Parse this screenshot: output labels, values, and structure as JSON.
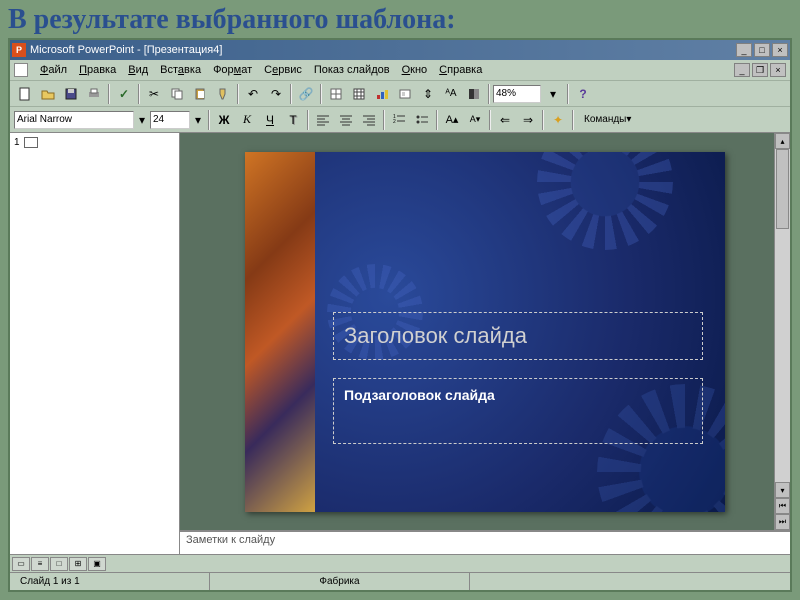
{
  "page": {
    "title": "В результате выбранного шаблона:"
  },
  "window": {
    "app_name": "Microsoft PowerPoint",
    "doc_name": "[Презентация4]"
  },
  "menu": {
    "file": "Файл",
    "edit": "Правка",
    "view": "Вид",
    "insert": "Вставка",
    "format": "Формат",
    "tools": "Сервис",
    "slideshow": "Показ слайдов",
    "window": "Окно",
    "help": "Справка"
  },
  "toolbar": {
    "zoom": "48%"
  },
  "format": {
    "font": "Arial Narrow",
    "size": "24",
    "commands": "Команды"
  },
  "slide": {
    "title_placeholder": "Заголовок слайда",
    "subtitle_placeholder": "Подзаголовок слайда"
  },
  "notes": {
    "placeholder": "Заметки к слайду"
  },
  "status": {
    "slide_info": "Слайд 1 из 1",
    "template": "Фабрика"
  },
  "outline": {
    "slide_number": "1"
  }
}
